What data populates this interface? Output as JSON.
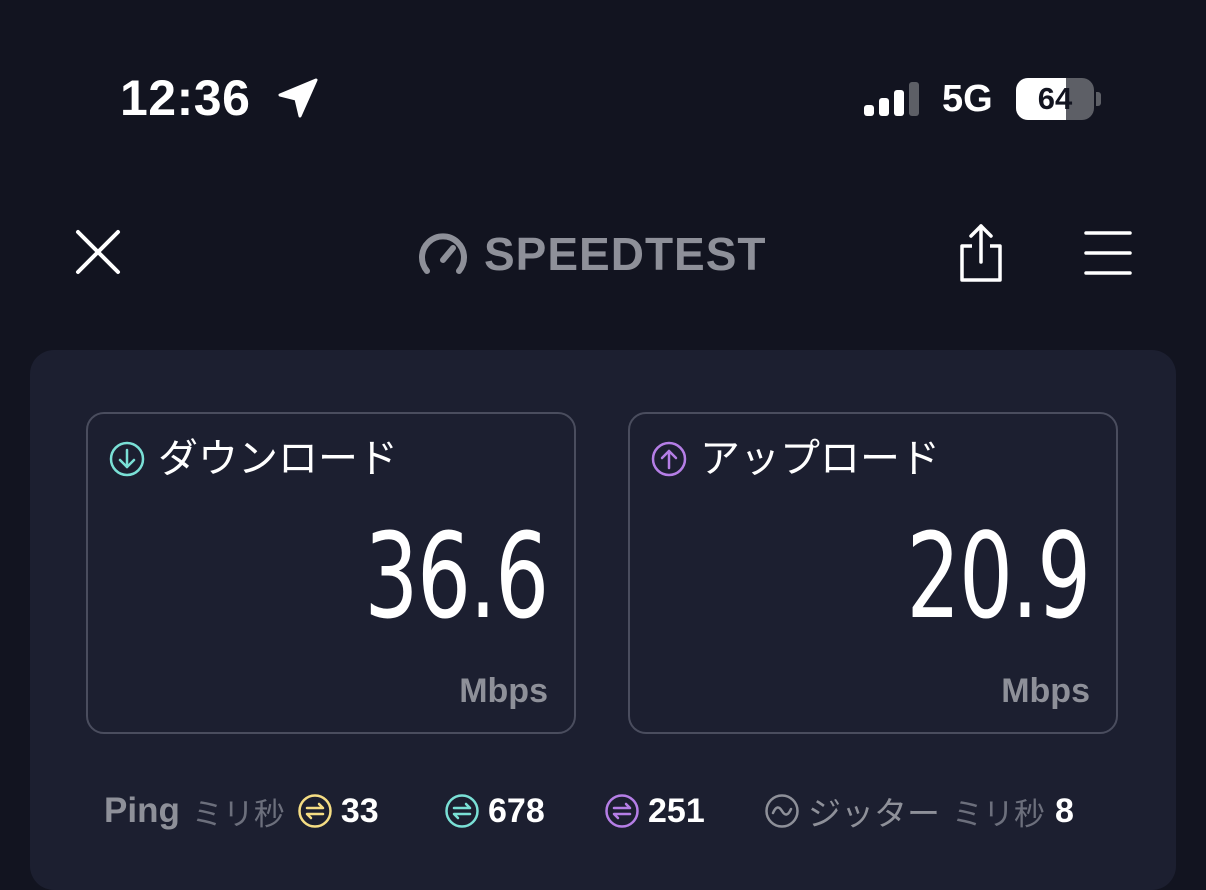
{
  "status_bar": {
    "time": "12:36",
    "network": "5G",
    "battery_level": 64,
    "battery_label": "64",
    "icons": [
      "location-arrow-icon",
      "cellular-signal-icon",
      "battery-icon"
    ]
  },
  "header": {
    "brand_name": "SPEEDTEST",
    "icons": [
      "close-icon",
      "speedometer-icon",
      "share-icon",
      "hamburger-menu-icon"
    ]
  },
  "results": {
    "download": {
      "label": "ダウンロード",
      "value": "36.6",
      "unit": "Mbps",
      "icon": "arrow-down-circle-icon",
      "color": "#7ae0d6"
    },
    "upload": {
      "label": "アップロード",
      "value": "20.9",
      "unit": "Mbps",
      "icon": "arrow-up-circle-icon",
      "color": "#b57ee6"
    }
  },
  "stats": {
    "ping_label": "Ping",
    "ping_unit": "ミリ秒",
    "idle_ping": {
      "value": "33",
      "icon": "ping-idle-icon",
      "color": "#f5dd83"
    },
    "download_ping": {
      "value": "678",
      "icon": "ping-download-icon",
      "color": "#7ae0d6"
    },
    "upload_ping": {
      "value": "251",
      "icon": "ping-upload-icon",
      "color": "#b57ee6"
    },
    "jitter_label": "ジッター",
    "jitter_unit": "ミリ秒",
    "jitter_value": "8",
    "jitter_icon": "jitter-wave-icon"
  },
  "colors": {
    "background": "#121420",
    "panel": "#1c1f30",
    "muted_text": "#8e9099"
  }
}
